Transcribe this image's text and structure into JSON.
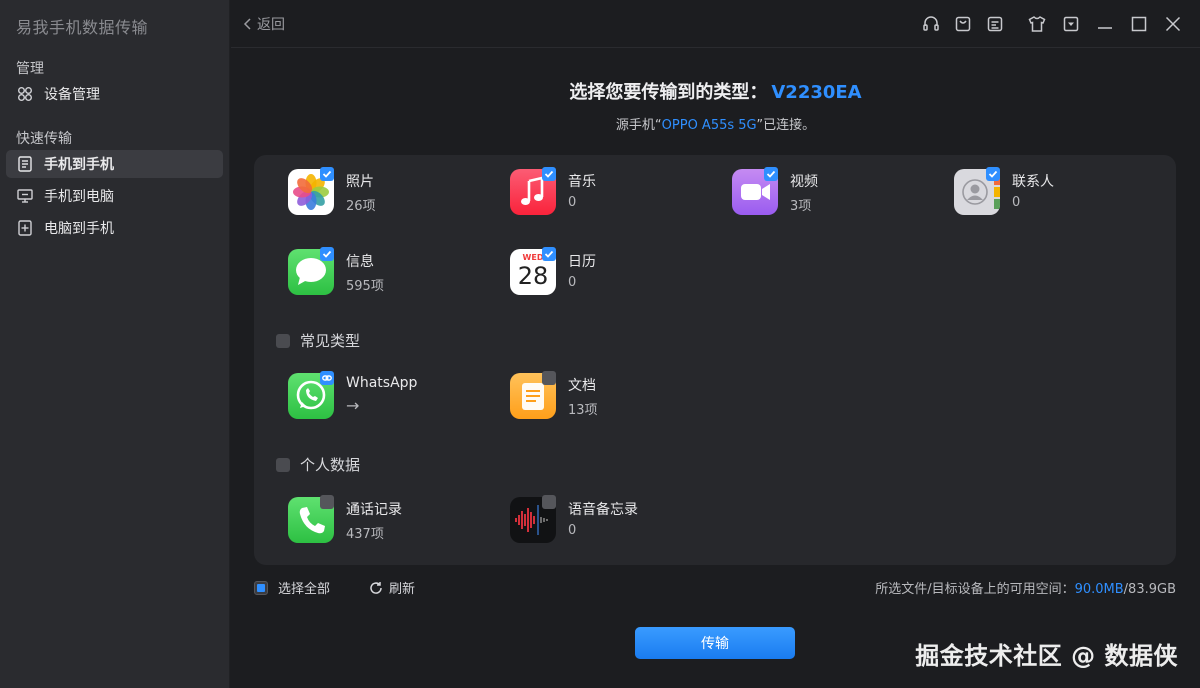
{
  "app": {
    "title": "易我手机数据传输"
  },
  "sidebar": {
    "section_manage": "管理",
    "device_manage": "设备管理",
    "section_quick": "快速传输",
    "items": [
      {
        "label": "手机到手机",
        "icon": "phone-to-phone-icon",
        "active": true
      },
      {
        "label": "手机到电脑",
        "icon": "phone-to-pc-icon",
        "active": false
      },
      {
        "label": "电脑到手机",
        "icon": "pc-to-phone-icon",
        "active": false
      }
    ]
  },
  "topbar": {
    "back_label": "返回",
    "icons": [
      "headset-icon",
      "bag-icon",
      "note-icon",
      "shirt-icon",
      "dropdown-icon",
      "minimize-icon",
      "maximize-icon",
      "close-icon"
    ]
  },
  "header": {
    "title_prefix": "选择您要传输到的类型：",
    "target_device": "V2230EA",
    "source_prefix": "源手机“",
    "source_device": "OPPO A55s 5G",
    "source_suffix": "”已连接。"
  },
  "items": {
    "photos": {
      "name": "照片",
      "count": "26项",
      "checked": true
    },
    "music": {
      "name": "音乐",
      "count": "0",
      "checked": true
    },
    "videos": {
      "name": "视频",
      "count": "3项",
      "checked": true
    },
    "contacts": {
      "name": "联系人",
      "count": "0",
      "checked": true
    },
    "messages": {
      "name": "信息",
      "count": "595项",
      "checked": true
    },
    "calendar": {
      "name": "日历",
      "count": "0",
      "checked": true,
      "icon_day": "28",
      "icon_weekday": "WED"
    },
    "whatsapp": {
      "name": "WhatsApp",
      "count": "→",
      "checked": false
    },
    "documents": {
      "name": "文档",
      "count": "13项",
      "checked": false
    },
    "call_log": {
      "name": "通话记录",
      "count": "437项",
      "checked": false
    },
    "voice_memos": {
      "name": "语音备忘录",
      "count": "0",
      "checked": false
    }
  },
  "categories": {
    "common": "常见类型",
    "personal": "个人数据"
  },
  "footer": {
    "select_all": "选择全部",
    "refresh": "刷新",
    "space_prefix": "所选文件/目标设备上的可用空间：",
    "space_selected": "90.0MB",
    "space_available": "/83.9GB",
    "transfer": "传输"
  },
  "watermark": "掘金技术社区 @ 数据侠",
  "colors": {
    "accent": "#2f8fff",
    "bg": "#1c1d20",
    "sidebar": "#2a2b2f",
    "panel": "#27282c"
  }
}
